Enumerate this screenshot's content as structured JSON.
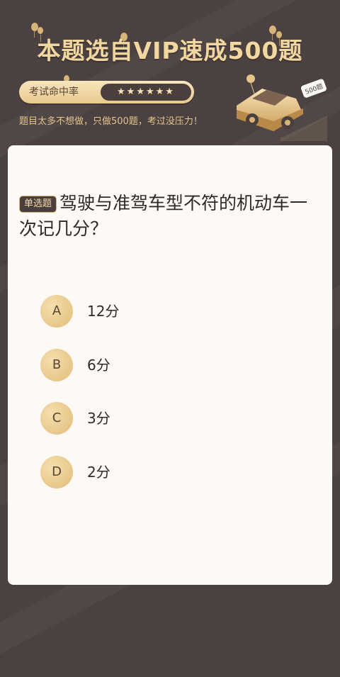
{
  "header": {
    "title": "本题选自VIP速成500题",
    "rate_label": "考试命中率",
    "stars": "★★★★★★",
    "subtitle": "题目太多不想做，只做500题，考过没压力！",
    "car_sign": "500题"
  },
  "question": {
    "type_badge": "单选题",
    "text": "驾驶与准驾车型不符的机动车一次记几分？",
    "options": [
      {
        "letter": "A",
        "text": "12分"
      },
      {
        "letter": "B",
        "text": "6分"
      },
      {
        "letter": "C",
        "text": "3分"
      },
      {
        "letter": "D",
        "text": "2分"
      }
    ]
  },
  "colors": {
    "background": "#4b4140",
    "gold": "#f3d7a0",
    "card": "#fdfaf6"
  }
}
